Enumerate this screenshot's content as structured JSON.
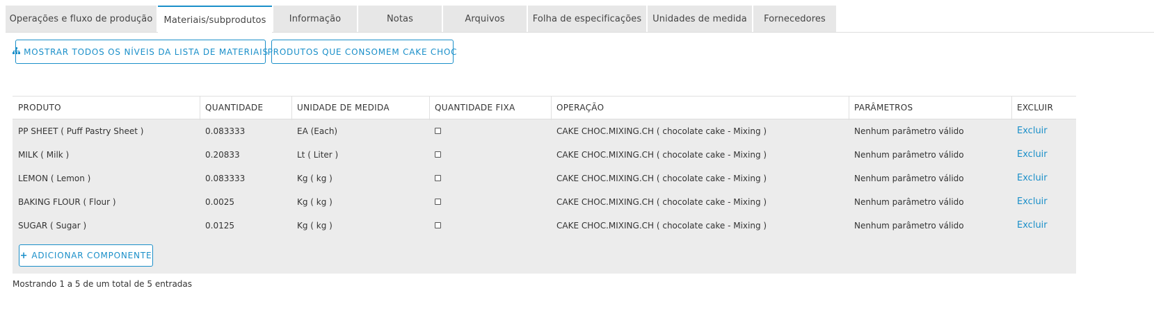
{
  "tabs": [
    {
      "label": "Operações e fluxo de produção",
      "active": false
    },
    {
      "label": "Materiais/subprodutos",
      "active": true
    },
    {
      "label": "Informação",
      "active": false
    },
    {
      "label": "Notas",
      "active": false
    },
    {
      "label": "Arquivos",
      "active": false
    },
    {
      "label": "Folha de especificações",
      "active": false
    },
    {
      "label": "Unidades de medida",
      "active": false
    },
    {
      "label": "Fornecedores",
      "active": false
    }
  ],
  "actions": {
    "show_levels_label": "MOSTRAR TODOS OS NÍVEIS DA LISTA DE MATERIAIS",
    "consumers_label": "PRODUTOS QUE CONSOMEM CAKE CHOC"
  },
  "table": {
    "headers": {
      "produto": "PRODUTO",
      "quantidade": "QUANTIDADE",
      "unidade": "UNIDADE DE MEDIDA",
      "fixa": "QUANTIDADE FIXA",
      "operacao": "OPERAÇÃO",
      "parametros": "PARÂMETROS",
      "excluir": "EXCLUIR"
    },
    "rows": [
      {
        "produto": "PP SHEET ( Puff Pastry Sheet )",
        "quantidade": "0.083333",
        "unidade": "EA (Each)",
        "fixa": false,
        "operacao": "CAKE CHOC.MIXING.CH ( chocolate cake - Mixing )",
        "parametros": "Nenhum parâmetro válido",
        "excluir": "Excluir"
      },
      {
        "produto": "MILK ( Milk )",
        "quantidade": "0.20833",
        "unidade": "Lt ( Liter )",
        "fixa": false,
        "operacao": "CAKE CHOC.MIXING.CH ( chocolate cake - Mixing )",
        "parametros": "Nenhum parâmetro válido",
        "excluir": "Excluir"
      },
      {
        "produto": "LEMON ( Lemon )",
        "quantidade": "0.083333",
        "unidade": "Kg ( kg )",
        "fixa": false,
        "operacao": "CAKE CHOC.MIXING.CH ( chocolate cake - Mixing )",
        "parametros": "Nenhum parâmetro válido",
        "excluir": "Excluir"
      },
      {
        "produto": "BAKING FLOUR ( Flour )",
        "quantidade": "0.0025",
        "unidade": "Kg ( kg )",
        "fixa": false,
        "operacao": "CAKE CHOC.MIXING.CH ( chocolate cake - Mixing )",
        "parametros": "Nenhum parâmetro válido",
        "excluir": "Excluir"
      },
      {
        "produto": "SUGAR ( Sugar )",
        "quantidade": "0.0125",
        "unidade": "Kg ( kg )",
        "fixa": false,
        "operacao": "CAKE CHOC.MIXING.CH ( chocolate cake - Mixing )",
        "parametros": "Nenhum parâmetro válido",
        "excluir": "Excluir"
      }
    ],
    "add_label": "ADICIONAR COMPONENTE",
    "footer": "Mostrando 1 a 5 de um total de 5 entradas"
  },
  "colors": {
    "accent": "#1a8fc9",
    "table_bg": "#ececec",
    "tab_bg": "#e7e7e7"
  },
  "icons": {
    "show_levels": "sitemap-icon",
    "add": "plus-icon"
  }
}
